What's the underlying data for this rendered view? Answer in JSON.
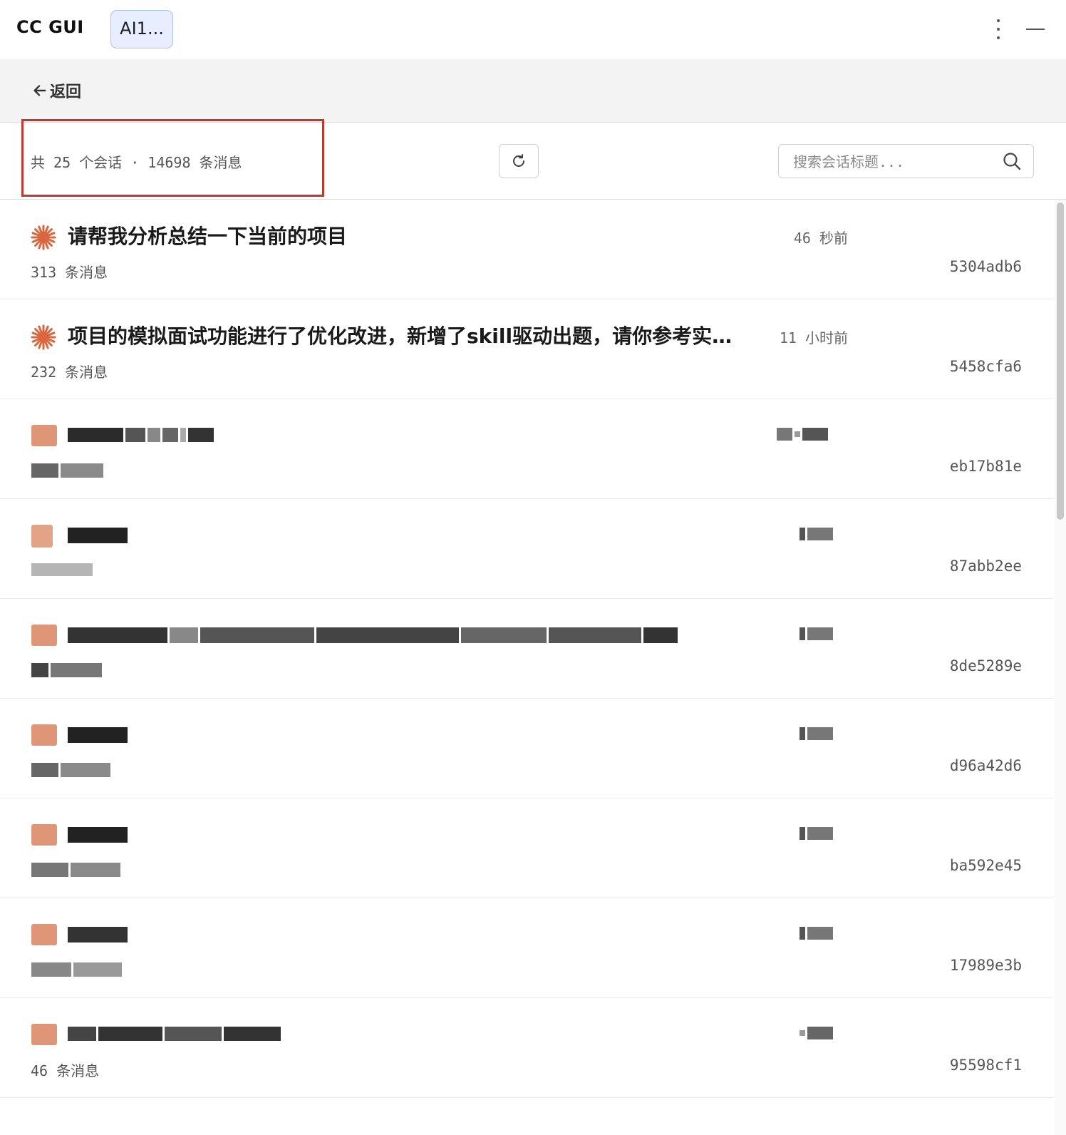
{
  "window": {
    "app_title": "CC GUI",
    "active_tab": "AI1..."
  },
  "nav": {
    "back_label": "返回"
  },
  "toolbar": {
    "summary": "共 25 个会话 · 14698 条消息",
    "search_placeholder": "搜索会话标题..."
  },
  "sessions": [
    {
      "title": "请帮我分析总结一下当前的项目",
      "time": "46 秒前",
      "count": "313 条消息",
      "id": "5304adb6",
      "obscured": false
    },
    {
      "title": "项目的模拟面试功能进行了优化改进，新增了skill驱动出题，请你参考实现方案并实施",
      "time": "11 小时前",
      "count": "232 条消息",
      "id": "5458cfa6",
      "obscured": false
    },
    {
      "title": "",
      "time": "",
      "count": "",
      "id": "eb17b81e",
      "obscured": true
    },
    {
      "title": "",
      "time": "",
      "count": "",
      "id": "87abb2ee",
      "obscured": true
    },
    {
      "title": "",
      "time": "",
      "count": "",
      "id": "8de5289e",
      "obscured": true
    },
    {
      "title": "",
      "time": "",
      "count": "",
      "id": "d96a42d6",
      "obscured": true
    },
    {
      "title": "",
      "time": "",
      "count": "",
      "id": "ba592e45",
      "obscured": true
    },
    {
      "title": "",
      "time": "",
      "count": "",
      "id": "17989e3b",
      "obscured": true
    },
    {
      "title": "",
      "time": "",
      "count": "46 条消息",
      "id": "95598cf1",
      "obscured": true
    }
  ],
  "colors": {
    "accent": "#d9673f",
    "highlight_border": "#c0392b",
    "tab_bg": "#e6eeff"
  }
}
